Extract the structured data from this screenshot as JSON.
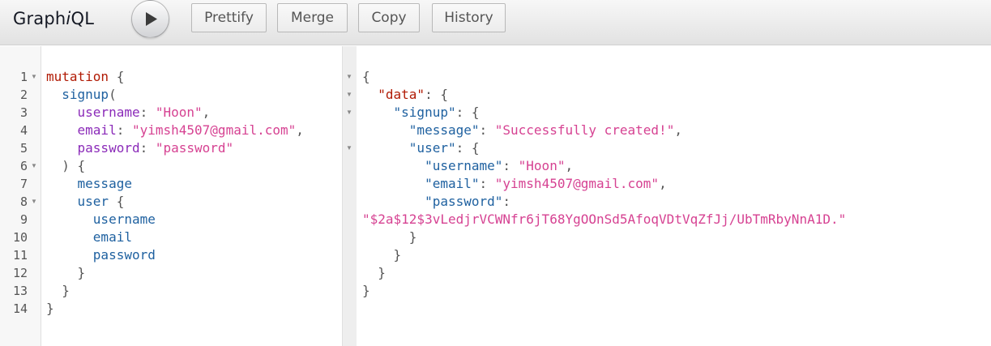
{
  "header": {
    "title_pre": "Graph",
    "title_em": "i",
    "title_post": "QL",
    "buttons": [
      "Prettify",
      "Merge",
      "Copy",
      "History"
    ]
  },
  "query": {
    "line_numbers": [
      "1",
      "2",
      "3",
      "4",
      "5",
      "6",
      "7",
      "8",
      "9",
      "10",
      "11",
      "12",
      "13",
      "14"
    ],
    "lines": [
      [
        {
          "t": "mutation",
          "c": "kw"
        },
        {
          "t": " {",
          "c": "punc"
        }
      ],
      [
        {
          "t": "  ",
          "c": "pl"
        },
        {
          "t": "signup",
          "c": "def"
        },
        {
          "t": "(",
          "c": "punc"
        }
      ],
      [
        {
          "t": "    ",
          "c": "pl"
        },
        {
          "t": "username",
          "c": "attr"
        },
        {
          "t": ": ",
          "c": "punc"
        },
        {
          "t": "\"Hoon\"",
          "c": "str"
        },
        {
          "t": ",",
          "c": "punc"
        }
      ],
      [
        {
          "t": "    ",
          "c": "pl"
        },
        {
          "t": "email",
          "c": "attr"
        },
        {
          "t": ": ",
          "c": "punc"
        },
        {
          "t": "\"yimsh4507@gmail.com\"",
          "c": "str"
        },
        {
          "t": ",",
          "c": "punc"
        }
      ],
      [
        {
          "t": "    ",
          "c": "pl"
        },
        {
          "t": "password",
          "c": "attr"
        },
        {
          "t": ": ",
          "c": "punc"
        },
        {
          "t": "\"password\"",
          "c": "str"
        }
      ],
      [
        {
          "t": "  ) {",
          "c": "punc"
        }
      ],
      [
        {
          "t": "    ",
          "c": "pl"
        },
        {
          "t": "message",
          "c": "def"
        }
      ],
      [
        {
          "t": "    ",
          "c": "pl"
        },
        {
          "t": "user",
          "c": "def"
        },
        {
          "t": " {",
          "c": "punc"
        }
      ],
      [
        {
          "t": "      ",
          "c": "pl"
        },
        {
          "t": "username",
          "c": "def"
        }
      ],
      [
        {
          "t": "      ",
          "c": "pl"
        },
        {
          "t": "email",
          "c": "def"
        }
      ],
      [
        {
          "t": "      ",
          "c": "pl"
        },
        {
          "t": "password",
          "c": "def"
        }
      ],
      [
        {
          "t": "    }",
          "c": "punc"
        }
      ],
      [
        {
          "t": "  }",
          "c": "punc"
        }
      ],
      [
        {
          "t": "}",
          "c": "punc"
        }
      ]
    ]
  },
  "result": {
    "lines": [
      [
        {
          "t": "{",
          "c": "punc"
        }
      ],
      [
        {
          "t": "  ",
          "c": "pl"
        },
        {
          "t": "\"data\"",
          "c": "kw"
        },
        {
          "t": ": {",
          "c": "punc"
        }
      ],
      [
        {
          "t": "    ",
          "c": "pl"
        },
        {
          "t": "\"signup\"",
          "c": "prop"
        },
        {
          "t": ": {",
          "c": "punc"
        }
      ],
      [
        {
          "t": "      ",
          "c": "pl"
        },
        {
          "t": "\"message\"",
          "c": "prop"
        },
        {
          "t": ": ",
          "c": "punc"
        },
        {
          "t": "\"Successfully created!\"",
          "c": "str"
        },
        {
          "t": ",",
          "c": "punc"
        }
      ],
      [
        {
          "t": "      ",
          "c": "pl"
        },
        {
          "t": "\"user\"",
          "c": "prop"
        },
        {
          "t": ": {",
          "c": "punc"
        }
      ],
      [
        {
          "t": "        ",
          "c": "pl"
        },
        {
          "t": "\"username\"",
          "c": "prop"
        },
        {
          "t": ": ",
          "c": "punc"
        },
        {
          "t": "\"Hoon\"",
          "c": "str"
        },
        {
          "t": ",",
          "c": "punc"
        }
      ],
      [
        {
          "t": "        ",
          "c": "pl"
        },
        {
          "t": "\"email\"",
          "c": "prop"
        },
        {
          "t": ": ",
          "c": "punc"
        },
        {
          "t": "\"yimsh4507@gmail.com\"",
          "c": "str"
        },
        {
          "t": ",",
          "c": "punc"
        }
      ],
      [
        {
          "t": "        ",
          "c": "pl"
        },
        {
          "t": "\"password\"",
          "c": "prop"
        },
        {
          "t": ":",
          "c": "punc"
        }
      ],
      [
        {
          "t": "\"$2a$12$3vLedjrVCWNfr6jT68YgOOnSd5AfoqVDtVqZfJj/UbTmRbyNnA1D.\"",
          "c": "str"
        }
      ],
      [
        {
          "t": "      }",
          "c": "punc"
        }
      ],
      [
        {
          "t": "    }",
          "c": "punc"
        }
      ],
      [
        {
          "t": "  }",
          "c": "punc"
        }
      ],
      [
        {
          "t": "}",
          "c": "punc"
        }
      ]
    ]
  }
}
